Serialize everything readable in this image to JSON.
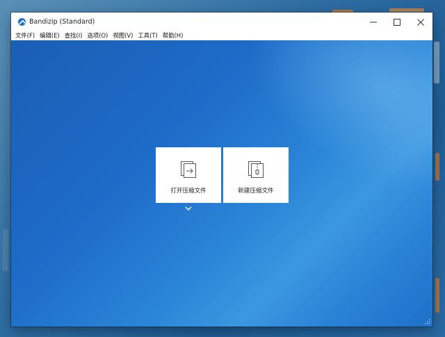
{
  "window": {
    "title": "Bandizip (Standard)",
    "icon": "bandizip-logo-icon"
  },
  "window_controls": {
    "minimize": "minimize-icon",
    "maximize": "maximize-icon",
    "close": "close-icon"
  },
  "menu": {
    "items": [
      {
        "label": "文件(F)"
      },
      {
        "label": "编辑(E)"
      },
      {
        "label": "查找(I)"
      },
      {
        "label": "选项(O)"
      },
      {
        "label": "视图(V)"
      },
      {
        "label": "工具(T)"
      },
      {
        "label": "帮助(H)"
      }
    ]
  },
  "actions": {
    "open_archive": {
      "label": "打开压缩文件",
      "icon": "open-archive-icon"
    },
    "new_archive": {
      "label": "新建压缩文件",
      "icon": "new-archive-icon"
    },
    "more": {
      "icon": "chevron-down-icon"
    }
  },
  "colors": {
    "background_start": "#1b5eb4",
    "background_end": "#3c97e0",
    "tile": "#ffffff",
    "logo": "#1e6fd0"
  }
}
